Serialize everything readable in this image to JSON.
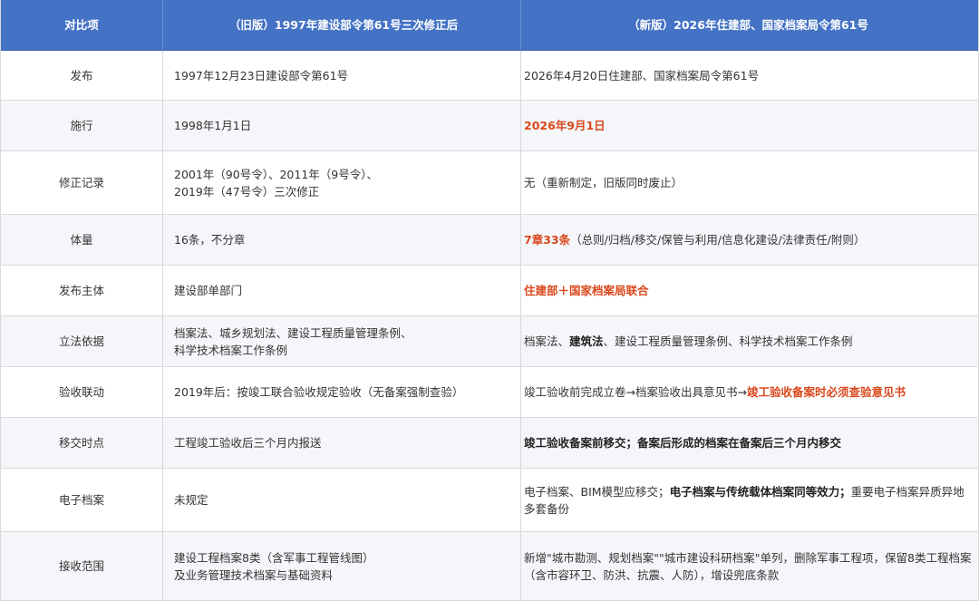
{
  "header": {
    "col1": "对比项",
    "col2": "（旧版）1997年建设部令第61号三次修正后",
    "col3": "（新版）2026年住建部、国家档案局令第61号"
  },
  "rows": [
    {
      "item": "发布",
      "old": [
        "1997年12月23日建设部令第61号"
      ],
      "new": [
        {
          "t": "2026年4月20日住建部、国家档案局令第61号",
          "s": "n"
        }
      ]
    },
    {
      "item": "施行",
      "old": [
        "1998年1月1日"
      ],
      "new": [
        {
          "t": "2026年9月1日",
          "s": "hl"
        }
      ]
    },
    {
      "item": "修正记录",
      "old": [
        "2001年（90号令）、2011年（9号令）、",
        "2019年（47号令）三次修正"
      ],
      "new": [
        {
          "t": "无（重新制定，旧版同时废止）",
          "s": "n"
        }
      ]
    },
    {
      "item": "体量",
      "old": [
        "16条，不分章"
      ],
      "new": [
        {
          "t": "7章33条",
          "s": "hl"
        },
        {
          "t": "（总则/归档/移交/保管与利用/信息化建设/法律责任/附则）",
          "s": "n"
        }
      ]
    },
    {
      "item": "发布主体",
      "old": [
        "建设部单部门"
      ],
      "new": [
        {
          "t": "住建部＋国家档案局联合",
          "s": "hl"
        }
      ]
    },
    {
      "item": "立法依据",
      "old": [
        "档案法、城乡规划法、建设工程质量管理条例、",
        "科学技术档案工作条例"
      ],
      "new": [
        {
          "t": "档案法、",
          "s": "n"
        },
        {
          "t": "建筑法",
          "s": "b"
        },
        {
          "t": "、建设工程质量管理条例、科学技术档案工作条例",
          "s": "n"
        }
      ]
    },
    {
      "item": "验收联动",
      "old": [
        "2019年后：按竣工联合验收规定验收（无备案强制查验）"
      ],
      "new": [
        {
          "t": "竣工验收前完成立卷→档案验收出具意见书→",
          "s": "n"
        },
        {
          "t": "竣工验收备案时必须查验意见书",
          "s": "hl"
        }
      ]
    },
    {
      "item": "移交时点",
      "old": [
        "工程竣工验收后三个月内报送"
      ],
      "new": [
        {
          "t": "竣工验收备案前移交；备案后形成的档案在备案后三个月内移交",
          "s": "b"
        }
      ]
    },
    {
      "item": "电子档案",
      "old": [
        "未规定"
      ],
      "new": [
        {
          "t": "电子档案、BIM模型应移交；",
          "s": "n"
        },
        {
          "t": "电子档案与传统载体档案同等效力；",
          "s": "b"
        },
        {
          "t": "重要电子档案异质异地多套备份",
          "s": "n"
        }
      ]
    },
    {
      "item": "接收范围",
      "old": [
        "建设工程档案8类（含军事工程管线图）",
        "及业务管理技术档案与基础资料"
      ],
      "new": [
        {
          "t": "新增\"城市勘测、规划档案\"\"城市建设科研档案\"单列，删除军事工程项，保留8类工程档案（含市容环卫、防洪、抗震、人防），增设兜底条款",
          "s": "n"
        }
      ]
    }
  ]
}
